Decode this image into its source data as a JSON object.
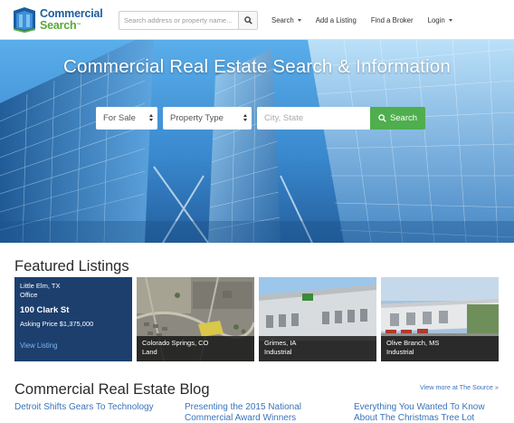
{
  "header": {
    "logo": {
      "line1": "Commercial",
      "line2": "Search",
      "tm": "™"
    },
    "search": {
      "placeholder": "Search address or property name..."
    },
    "nav": [
      {
        "label": "Search",
        "has_caret": true
      },
      {
        "label": "Add a Listing",
        "has_caret": false
      },
      {
        "label": "Find a Broker",
        "has_caret": false
      },
      {
        "label": "Login",
        "has_caret": true
      }
    ]
  },
  "hero": {
    "title": "Commercial Real Estate Search & Information",
    "listing_type": "For Sale",
    "property_type": "Property Type",
    "location_placeholder": "City, State",
    "search_button": "Search"
  },
  "featured": {
    "title": "Featured Listings",
    "listings": [
      {
        "location": "Little Elm, TX",
        "type": "Office",
        "address": "100 Clark St",
        "price": "Asking Price $1,375,000",
        "link": "View Listing"
      },
      {
        "location": "Colorado Springs, CO",
        "type": "Land"
      },
      {
        "location": "Grimes, IA",
        "type": "Industrial"
      },
      {
        "location": "Olive Branch, MS",
        "type": "Industrial"
      }
    ]
  },
  "blog": {
    "title": "Commercial Real Estate Blog",
    "more_link": "View more at The Source »",
    "posts": [
      "Detroit Shifts Gears To Technology",
      "Presenting the 2015 National Commercial Award Winners",
      "Everything You Wanted To Know About The Christmas Tree Lot"
    ]
  },
  "colors": {
    "brand_blue": "#1b5e9c",
    "brand_green": "#5aa83a",
    "search_button": "#4fae4e",
    "featured_card": "#1d3f6e",
    "link": "#3b73b9"
  },
  "icons": [
    "building-logo-icon",
    "search-icon",
    "chevron-down-icon"
  ]
}
